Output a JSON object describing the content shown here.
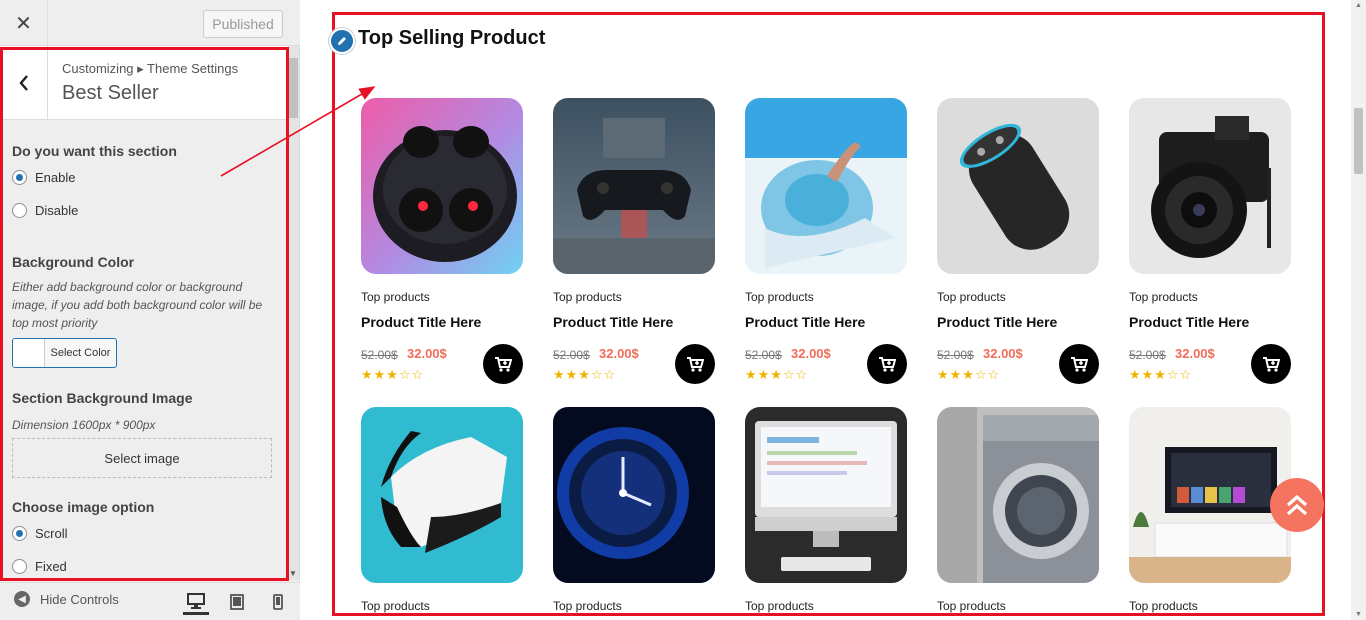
{
  "topbar": {
    "close_symbol": "✕",
    "published_label": "Published"
  },
  "panel": {
    "breadcrumb": "Customizing ▸ Theme Settings",
    "title": "Best Seller",
    "section_toggle": {
      "heading": "Do you want this section",
      "options": [
        "Enable",
        "Disable"
      ],
      "selected": "Enable"
    },
    "background_color": {
      "heading": "Background Color",
      "description": "Either add background color or background image, if you add both background color will be top most priority",
      "button_label": "Select Color"
    },
    "background_image": {
      "heading": "Section Background Image",
      "description": "Dimension 1600px * 900px",
      "button_label": "Select image"
    },
    "image_option": {
      "heading": "Choose image option",
      "options": [
        "Scroll",
        "Fixed"
      ],
      "selected": "Scroll"
    }
  },
  "footer": {
    "hide_controls_label": "Hide Controls",
    "devices": [
      "desktop-icon",
      "tablet-icon",
      "mobile-icon"
    ],
    "active_device": "desktop"
  },
  "preview": {
    "section_title": "Top Selling Product",
    "products": [
      {
        "category": "Top products",
        "title": "Product Title Here",
        "old_price": "52.00$",
        "new_price": "32.00$",
        "rating": 3,
        "image": "earbuds"
      },
      {
        "category": "Top products",
        "title": "Product Title Here",
        "old_price": "52.00$",
        "new_price": "32.00$",
        "rating": 3,
        "image": "gamepad"
      },
      {
        "category": "Top products",
        "title": "Product Title Here",
        "old_price": "52.00$",
        "new_price": "32.00$",
        "rating": 3,
        "image": "beach-hat"
      },
      {
        "category": "Top products",
        "title": "Product Title Here",
        "old_price": "52.00$",
        "new_price": "32.00$",
        "rating": 3,
        "image": "smart-speaker"
      },
      {
        "category": "Top products",
        "title": "Product Title Here",
        "old_price": "52.00$",
        "new_price": "32.00$",
        "rating": 3,
        "image": "camera"
      },
      {
        "category": "Top products",
        "image": "vr-headset"
      },
      {
        "category": "Top products",
        "image": "smartwatch"
      },
      {
        "category": "Top products",
        "image": "desktop-computer"
      },
      {
        "category": "Top products",
        "image": "washing-machine"
      },
      {
        "category": "Top products",
        "image": "television"
      }
    ]
  },
  "colors": {
    "highlight_border": "#e81123",
    "price_accent": "#f56b5a",
    "star": "#f0b400",
    "scroll_top_button": "#f47460",
    "wp_blue": "#2271b1"
  }
}
